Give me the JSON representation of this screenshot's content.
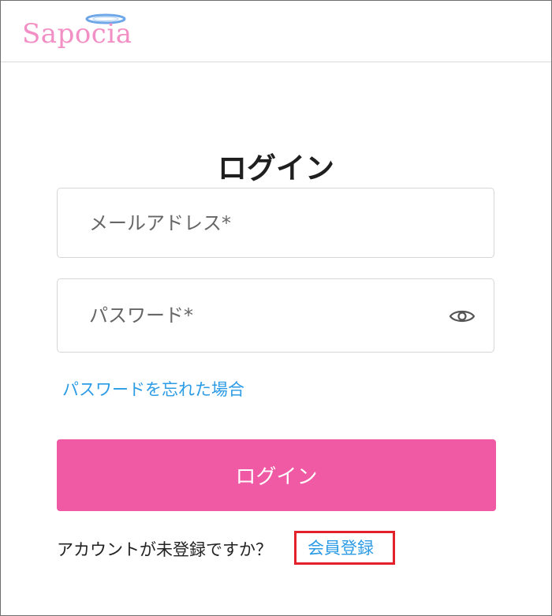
{
  "header": {
    "logo_text": "Sapocia",
    "logo_color": "#f28fc4",
    "halo_color": "#6ea7e8"
  },
  "login": {
    "title": "ログイン",
    "email_placeholder": "メールアドレス*",
    "email_value": "",
    "password_placeholder": "パスワード*",
    "password_value": "",
    "forgot_password_label": "パスワードを忘れた場合",
    "submit_label": "ログイン",
    "signup_prompt": "アカウントが未登録ですか？",
    "signup_label": "会員登録"
  },
  "icons": {
    "password_visibility": "eye-icon"
  },
  "colors": {
    "accent_pink": "#f05aa5",
    "link_blue": "#2b9be6",
    "highlight_red": "#e2212a"
  }
}
